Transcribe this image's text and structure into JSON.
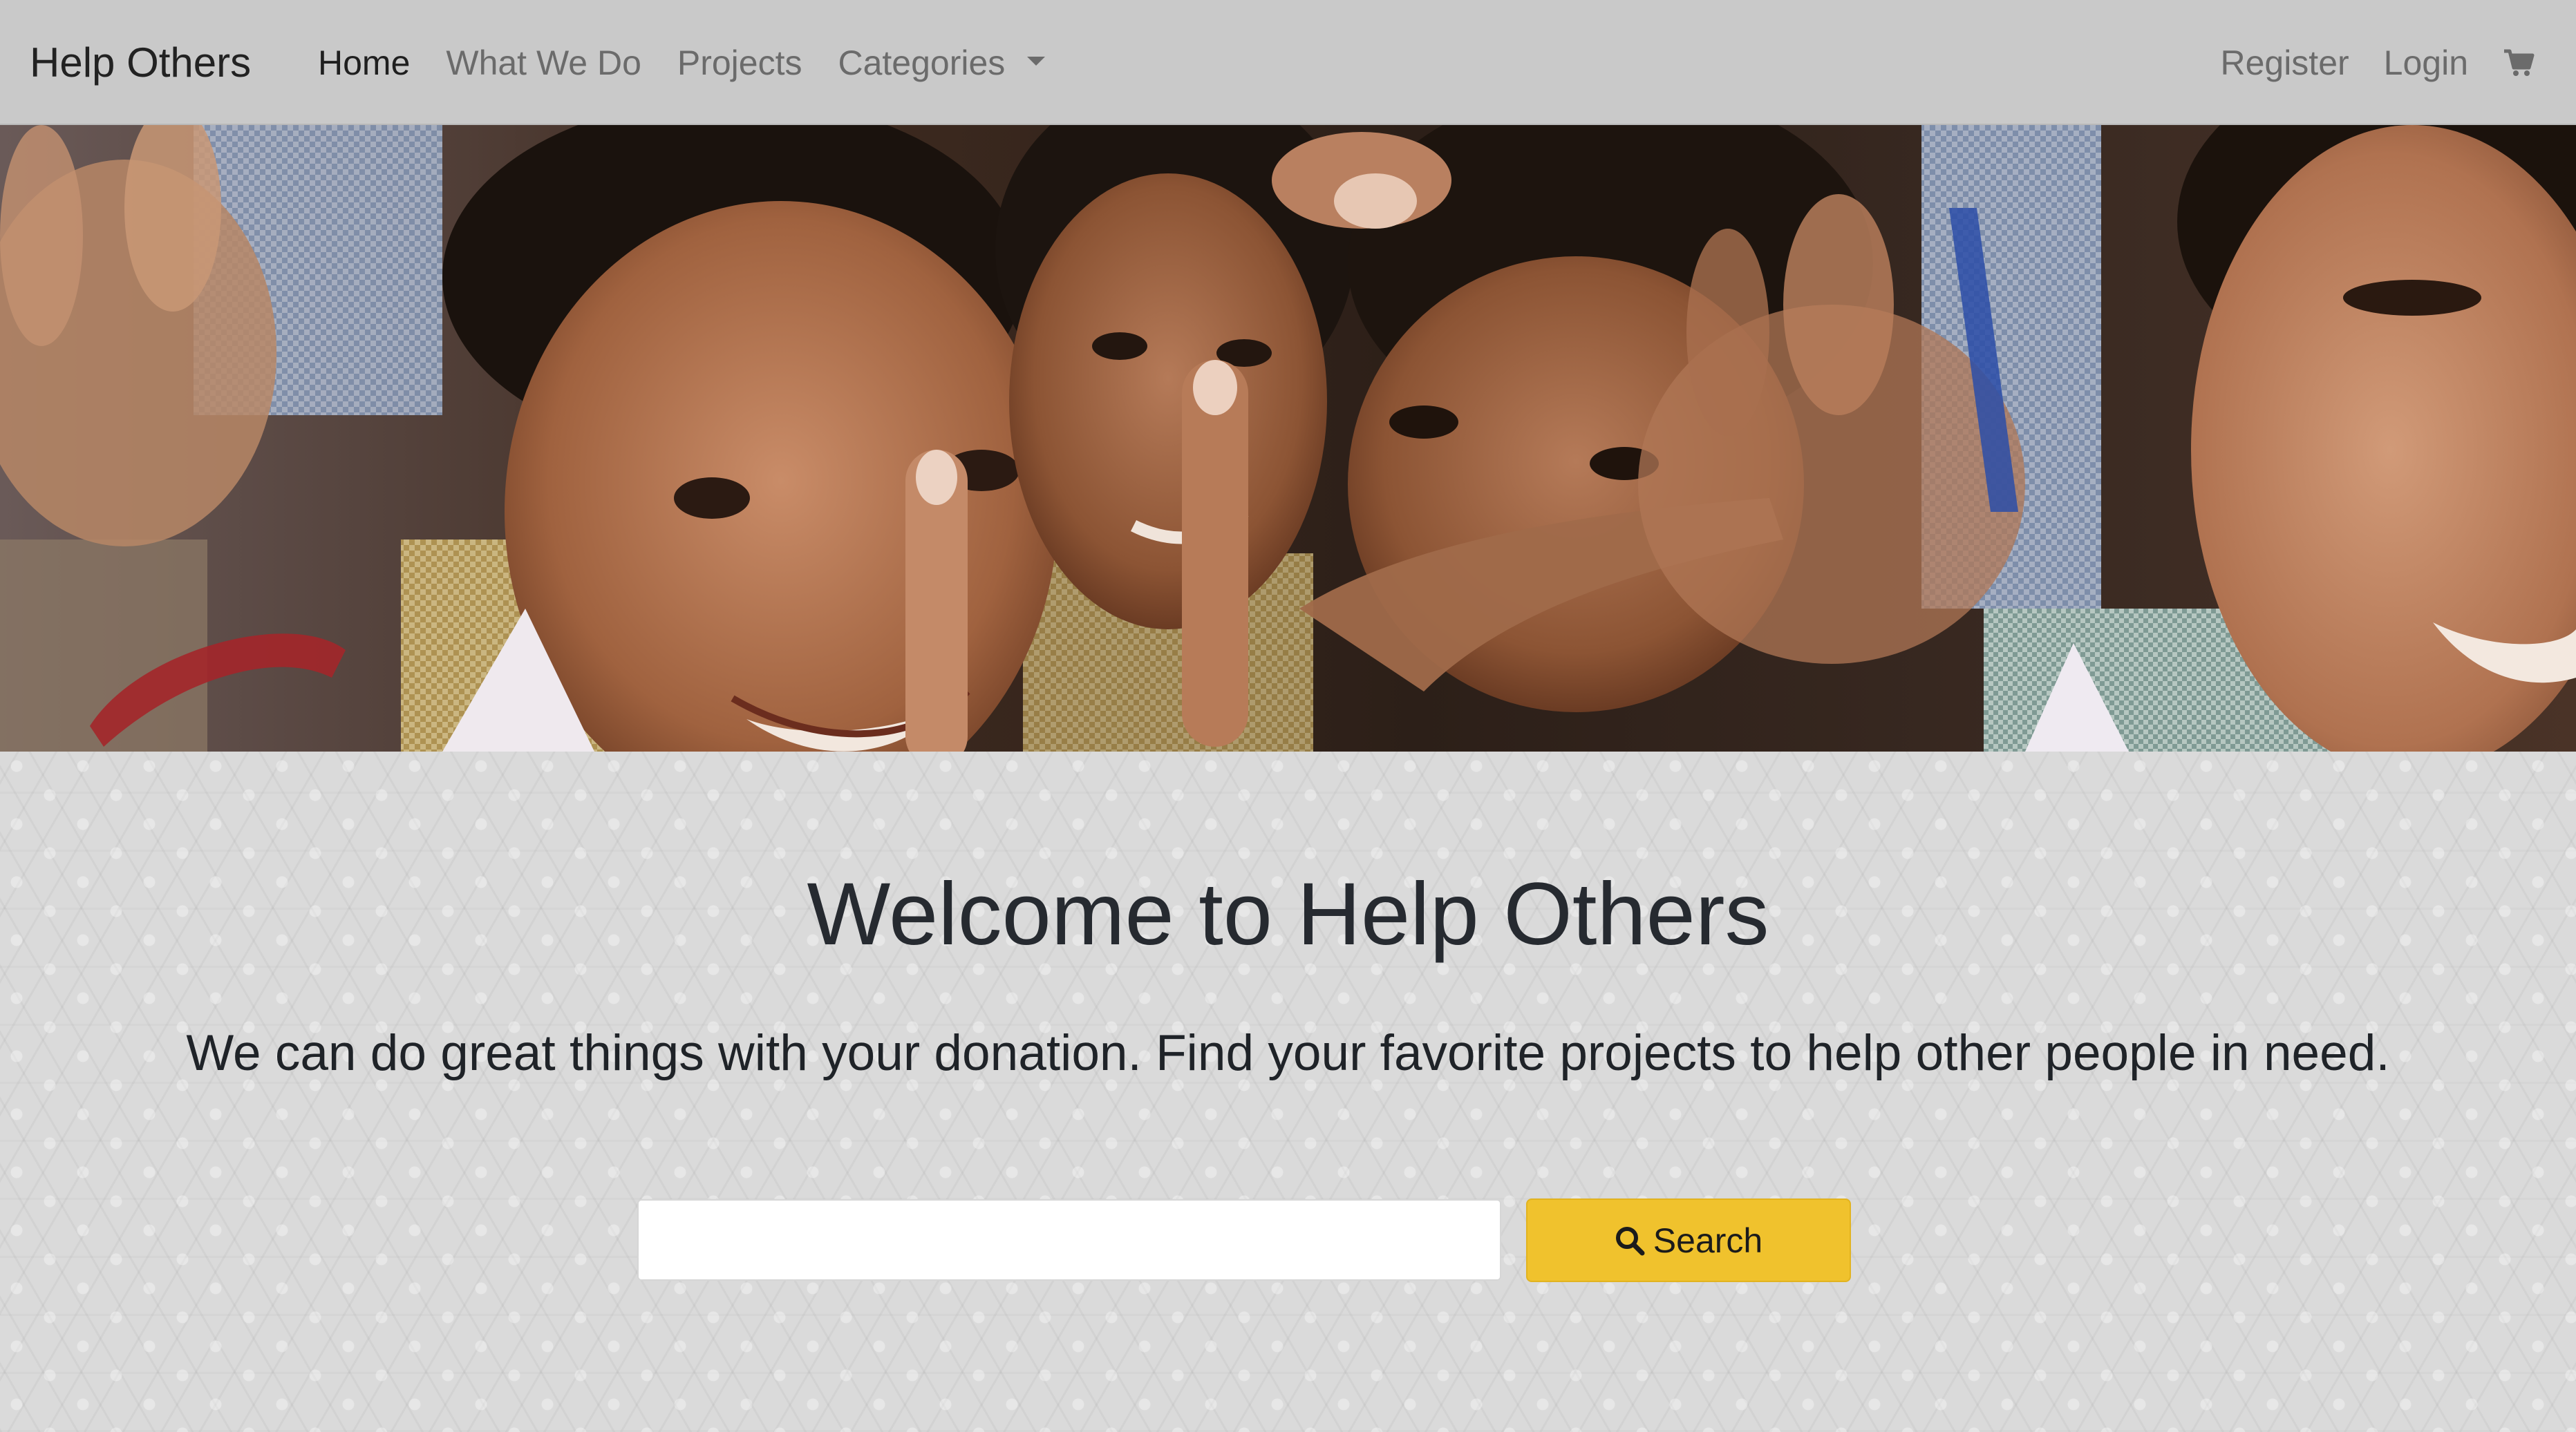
{
  "navbar": {
    "brand": "Help Others",
    "links": [
      {
        "label": "Home",
        "active": true
      },
      {
        "label": "What We Do",
        "active": false
      },
      {
        "label": "Projects",
        "active": false
      },
      {
        "label": "Categories",
        "active": false,
        "dropdown": true
      }
    ],
    "right": {
      "register": "Register",
      "login": "Login",
      "cart_icon": "shopping-cart-icon"
    }
  },
  "hero": {
    "image": "children-smiling-peace-signs-photo"
  },
  "main": {
    "title": "Welcome to Help Others",
    "subtitle": "We can do great things with your donation. Find your favorite projects to help other people in need.",
    "search": {
      "value": "",
      "placeholder": "",
      "button_label": "Search",
      "button_icon": "search-icon",
      "button_color": "#f0c22d"
    }
  },
  "colors": {
    "navbar_bg": "#c9c9c9",
    "page_bg": "#dadada",
    "accent": "#f0c22d",
    "text_dark": "#262a30",
    "nav_muted": "#6b6b6b"
  }
}
